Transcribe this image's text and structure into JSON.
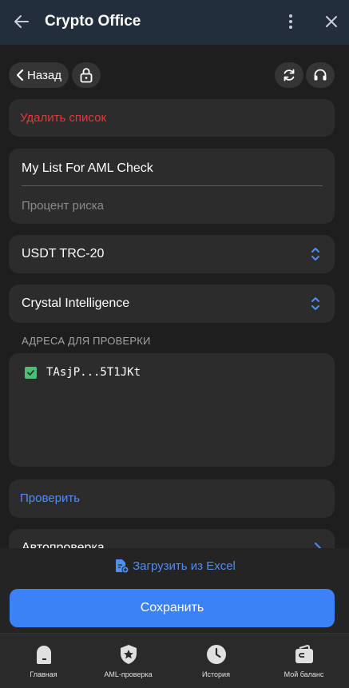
{
  "titlebar": {
    "title": "Crypto Office"
  },
  "toolbar": {
    "back_label": "Назад"
  },
  "delete_list": {
    "label": "Удалить список"
  },
  "list_form": {
    "name_value": "My List For AML Check",
    "risk_placeholder": "Процент риска"
  },
  "selectors": {
    "coin": "USDT TRC-20",
    "provider": "Crystal Intelligence"
  },
  "addresses": {
    "section_label": "АДРЕСА ДЛЯ ПРОВЕРКИ",
    "items": [
      {
        "address": "TAsjP...5T1JKt",
        "checked": true
      }
    ]
  },
  "check_action": {
    "label": "Проверить"
  },
  "auto_check": {
    "label": "Автопроверка"
  },
  "bottom": {
    "excel_label": "Загрузить из Excel",
    "save_label": "Сохранить"
  },
  "nav": {
    "items": [
      {
        "label": "Главная",
        "icon": "home-icon"
      },
      {
        "label": "AML-проверка",
        "icon": "shield-star-icon"
      },
      {
        "label": "История",
        "icon": "clock-icon"
      },
      {
        "label": "Мой баланс",
        "icon": "wallet-icon"
      }
    ]
  },
  "colors": {
    "accent": "#3a82f6",
    "link": "#4d8ef7",
    "danger": "#e53935",
    "check": "#4bbf73"
  }
}
